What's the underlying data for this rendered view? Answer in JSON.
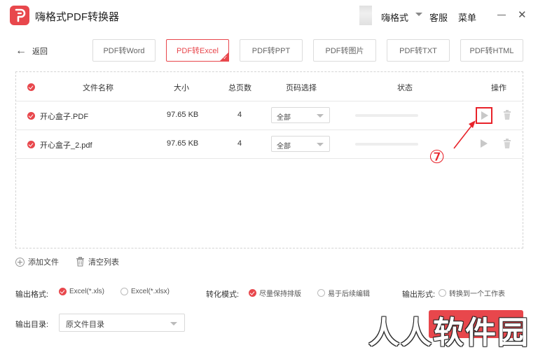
{
  "app": {
    "title": "嗨格式PDF转换器"
  },
  "titlebar": {
    "user_name": "嗨格式",
    "service_label": "客服",
    "menu_label": "菜单",
    "close_glyph": "✕"
  },
  "nav": {
    "back_label": "返回",
    "back_glyph": "←"
  },
  "tabs": [
    {
      "label": "PDF转Word",
      "active": false
    },
    {
      "label": "PDF转Excel",
      "active": true
    },
    {
      "label": "PDF转PPT",
      "active": false
    },
    {
      "label": "PDF转图片",
      "active": false
    },
    {
      "label": "PDF转TXT",
      "active": false
    },
    {
      "label": "PDF转HTML",
      "active": false
    }
  ],
  "table": {
    "headers": {
      "name": "文件名称",
      "size": "大小",
      "pages": "总页数",
      "page_select": "页码选择",
      "status": "状态",
      "action": "操作"
    },
    "rows": [
      {
        "name": "开心盒子.PDF",
        "size": "97.65 KB",
        "pages": "4",
        "page_select": "全部",
        "progress": 0
      },
      {
        "name": "开心盒子_2.pdf",
        "size": "97.65 KB",
        "pages": "4",
        "page_select": "全部",
        "progress": 0
      }
    ]
  },
  "annotation": {
    "step": "⑦",
    "color": "#e8232a"
  },
  "toolbar": {
    "add_file": "添加文件",
    "clear_list": "清空列表"
  },
  "options": {
    "output_format_label": "输出格式:",
    "format_xls": "Excel(*.xls)",
    "format_xlsx": "Excel(*.xlsx)",
    "convert_mode_label": "转化模式:",
    "mode_keep_layout": "尽量保持排版",
    "mode_easy_edit": "易于后续编辑",
    "output_form_label": "输出形式:",
    "form_single_sheet": "转换到一个工作表",
    "output_dir_label": "输出目录:",
    "output_dir_value": "原文件目录"
  },
  "watermark": "人人软件园",
  "colors": {
    "accent": "#e8474c"
  }
}
